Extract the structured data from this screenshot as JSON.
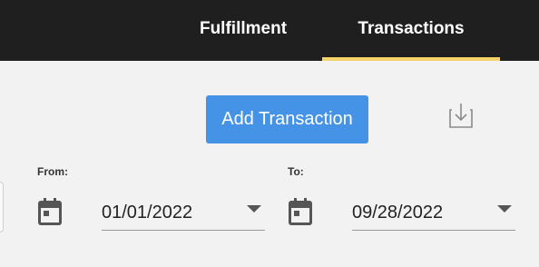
{
  "nav": {
    "tabs": [
      {
        "label": "Fulfillment",
        "active": false
      },
      {
        "label": "Transactions",
        "active": true
      }
    ],
    "active_underline_color": "#f3d36a"
  },
  "actions": {
    "add_transaction_label": "Add Transaction",
    "download_icon": "download-icon"
  },
  "filters": {
    "from": {
      "label": "From:",
      "value": "01/01/2022",
      "icon": "calendar-icon"
    },
    "to": {
      "label": "To:",
      "value": "09/28/2022",
      "icon": "calendar-icon"
    }
  },
  "colors": {
    "topbar": "#1f1f1f",
    "primary_button": "#4593e6",
    "background": "#f2f2f2"
  }
}
